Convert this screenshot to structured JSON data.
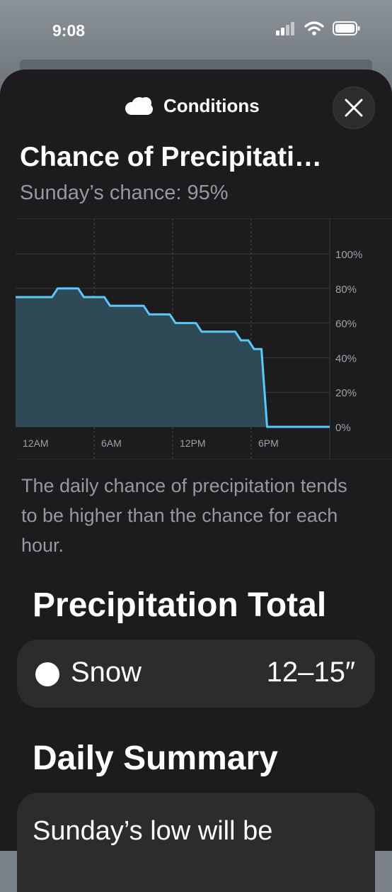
{
  "status_bar": {
    "time": "9:08",
    "signal_icon": "signal-bars-icon",
    "wifi_icon": "wifi-icon",
    "battery_icon": "battery-icon"
  },
  "sheet": {
    "title": "Conditions",
    "title_icon": "cloud-icon",
    "close_icon": "close-icon"
  },
  "heading": "Chance of Precipitati…",
  "subheading": "Sunday’s chance: 95%",
  "chart_data": {
    "type": "area",
    "x_labels": [
      "12AM",
      "6AM",
      "12PM",
      "6PM"
    ],
    "y_ticks": [
      "0%",
      "20%",
      "40%",
      "60%",
      "80%",
      "100%"
    ],
    "ylim": [
      0,
      100
    ],
    "x_hours": [
      0,
      1,
      2,
      3,
      4,
      5,
      6,
      7,
      8,
      9,
      10,
      11,
      12,
      13,
      14,
      15,
      16,
      17,
      18,
      19,
      20,
      21,
      22,
      23
    ],
    "values": [
      75,
      75,
      75,
      80,
      80,
      75,
      75,
      70,
      70,
      70,
      65,
      65,
      60,
      60,
      55,
      55,
      55,
      50,
      45,
      0,
      0,
      0,
      0,
      0
    ],
    "grid": true,
    "colors": {
      "line": "#5ac8fa",
      "fill": "#2e4a56"
    }
  },
  "note": "The daily chance of precipitation tends to be higher than the chance for each hour.",
  "precip_total": {
    "title": "Precipitation Total",
    "label": "Snow",
    "value": "12–15″"
  },
  "daily_summary": {
    "title": "Daily Summary",
    "text": "Sunday’s low will be"
  }
}
